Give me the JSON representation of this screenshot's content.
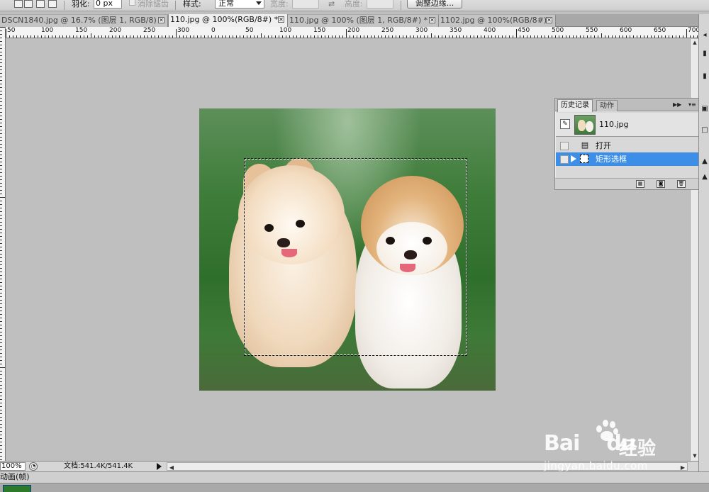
{
  "options_bar": {
    "feather_label": "羽化:",
    "feather_value": "0 px",
    "antialias_label": "消除锯齿",
    "style_label": "样式:",
    "style_value": "正常",
    "width_label": "宽度:",
    "height_label": "高度:",
    "refine_edge_button": "调整边缘..."
  },
  "tabs": [
    {
      "label": "DSCN1840.jpg @ 16.7% (图层 1, RGB/8) *",
      "active": false
    },
    {
      "label": "110.jpg @ 100%(RGB/8#) *",
      "active": true
    },
    {
      "label": "110.jpg @ 100% (图层 1, RGB/8#) *",
      "active": false
    },
    {
      "label": "1102.jpg @ 100%(RGB/8#)",
      "active": false
    }
  ],
  "ruler_labels": [
    "50",
    "100",
    "150",
    "200",
    "250",
    "300",
    "350",
    "400",
    "450",
    "500",
    "550",
    "600",
    "650",
    "700"
  ],
  "hruler": {
    "labels": [
      "0",
      "50",
      "100",
      "150",
      "200",
      "250",
      "300",
      "350",
      "400",
      "450",
      "500",
      "550",
      "600",
      "650",
      "700"
    ]
  },
  "history_panel": {
    "tabs": [
      "历史记录",
      "动作"
    ],
    "snapshot_name": "110.jpg",
    "steps": [
      {
        "label": "打开",
        "selected": false
      },
      {
        "label": "矩形选框",
        "selected": true
      }
    ]
  },
  "status_bar": {
    "zoom": "100%",
    "doc_info": "文档:541.4K/541.4K"
  },
  "animation_panel": {
    "title": "动画(帧)"
  },
  "watermark": {
    "brand": "Bai",
    "brand2": "du",
    "cn": "经验",
    "url": "jingyan.baidu.com"
  },
  "colors": {
    "selection_highlight": "#3d8ee6",
    "canvas_bg": "#bfbfbf"
  }
}
